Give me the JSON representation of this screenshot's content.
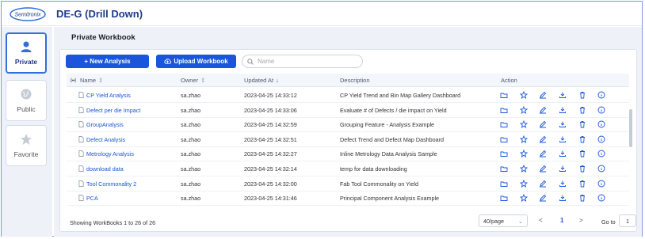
{
  "app": {
    "logo_text": "Semitronix",
    "title": "DE-G (Drill Down)"
  },
  "sidebar": {
    "items": [
      {
        "label": "Private",
        "active": true
      },
      {
        "label": "Public",
        "active": false
      },
      {
        "label": "Favorite",
        "active": false
      }
    ]
  },
  "main": {
    "section_title": "Private Workbook",
    "new_analysis_label": "+ New Analysis",
    "upload_workbook_label": "Upload Workbook",
    "search_placeholder": "Name"
  },
  "table": {
    "columns": {
      "name": "Name",
      "owner": "Owner",
      "updated_at": "Updated At",
      "description": "Description",
      "action": "Action"
    },
    "rows": [
      {
        "name": "CP Yield Analysis",
        "owner": "sa.zhao",
        "updated": "2023-04-25 14:33:12",
        "description": "CP Yield Trend and Bin Map Gallery Dashboard"
      },
      {
        "name": "Defect per die Impact",
        "owner": "sa.zhao",
        "updated": "2023-04-25 14:33:06",
        "description": "Evaluate # of Defects / die impact on Yield"
      },
      {
        "name": "GroupAnalysis",
        "owner": "sa.zhao",
        "updated": "2023-04-25 14:32:59",
        "description": "Grouping Feature - Analysis Example"
      },
      {
        "name": "Defect Analysis",
        "owner": "sa.zhao",
        "updated": "2023-04-25 14:32:51",
        "description": "Defect Trend and Defect Map Dashboard"
      },
      {
        "name": "Metrology Analysis",
        "owner": "sa.zhao",
        "updated": "2023-04-25 14:32:27",
        "description": "Inline Metrology Data Analysis Sample"
      },
      {
        "name": "download data",
        "owner": "sa.zhao",
        "updated": "2023-04-25 14:32:14",
        "description": "temp for data downloading"
      },
      {
        "name": "Tool Commonality 2",
        "owner": "sa.zhao",
        "updated": "2023-04-25 14:32:00",
        "description": "Fab Tool Commonality on Yield"
      },
      {
        "name": "PCA",
        "owner": "sa.zhao",
        "updated": "2023-04-25 14:31:46",
        "description": "Principal Component Analysis Example"
      }
    ]
  },
  "footer": {
    "showing": "Showing WorkBooks 1 to 26 of 26",
    "page_size": "40/page",
    "prev": "<",
    "current_page": "1",
    "next": ">",
    "goto_label": "Go to",
    "goto_value": "1"
  },
  "colors": {
    "accent": "#1a56db",
    "title": "#1f3a8a",
    "background": "#eef2f8"
  }
}
